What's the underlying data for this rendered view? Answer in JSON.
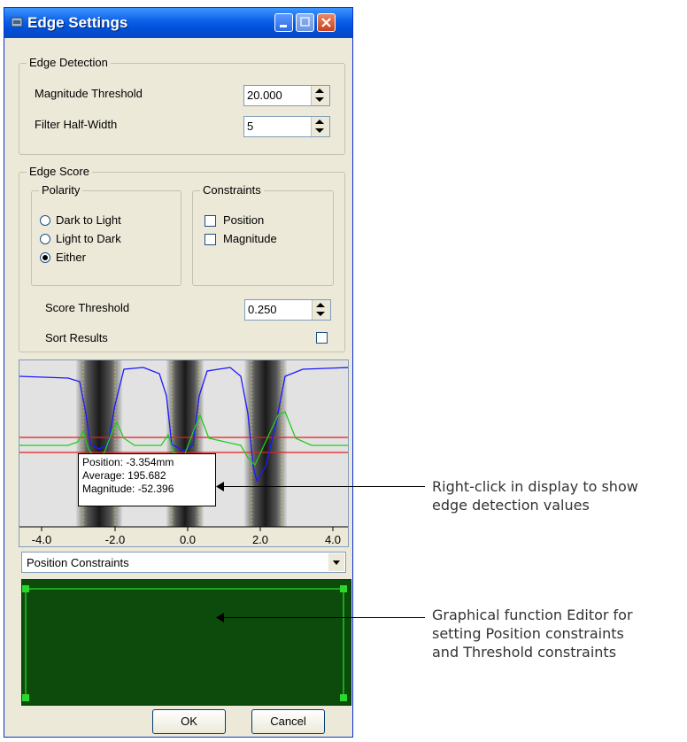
{
  "window": {
    "title": "Edge Settings"
  },
  "edge_detection": {
    "legend": "Edge Detection",
    "magnitude_threshold_label": "Magnitude Threshold",
    "magnitude_threshold_value": "20.000",
    "filter_half_width_label": "Filter Half-Width",
    "filter_half_width_value": "5"
  },
  "edge_score": {
    "legend": "Edge Score",
    "polarity": {
      "legend": "Polarity",
      "options": [
        "Dark to Light",
        "Light to Dark",
        "Either"
      ],
      "selected": "Either"
    },
    "constraints": {
      "legend": "Constraints",
      "options": [
        "Position",
        "Magnitude"
      ]
    },
    "score_threshold_label": "Score Threshold",
    "score_threshold_value": "0.250",
    "sort_results_label": "Sort Results"
  },
  "display": {
    "axis_ticks": [
      "-4.0",
      "-2.0",
      "0.0",
      "2.0",
      "4.0"
    ],
    "tooltip": {
      "position": "Position: -3.354mm",
      "average": "Average: 195.682",
      "magnitude": "Magnitude: -52.396"
    }
  },
  "constraint_select": {
    "value": "Position Constraints"
  },
  "buttons": {
    "ok": "OK",
    "cancel": "Cancel"
  },
  "annotations": {
    "display_note": [
      "Right-click in display to show",
      "edge detection values"
    ],
    "editor_note": [
      "Graphical function Editor for",
      "setting Position constraints",
      "and Threshold constraints"
    ]
  },
  "colors": {
    "title_bar": "#0a5fe6",
    "dialog_bg": "#ece9d8",
    "editor_bg": "#0c4b0c",
    "editor_handles": "#22c322",
    "average_curve": "#1a1aff",
    "magnitude_curve": "#22cc22",
    "threshold_lines": "#e02020"
  }
}
